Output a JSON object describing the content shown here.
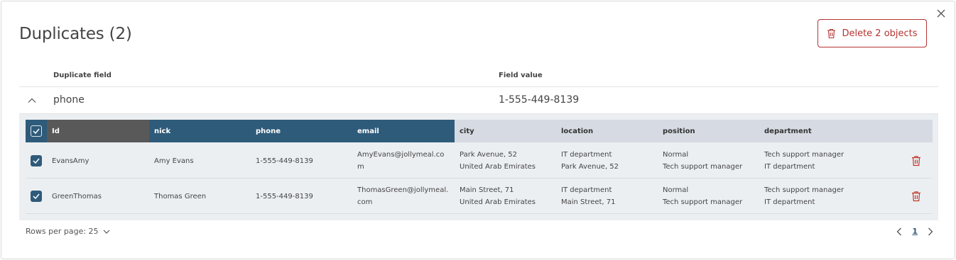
{
  "dialog": {
    "title": "Duplicates (2)",
    "delete_label": "Delete 2 objects"
  },
  "dup_header": {
    "field_label": "Duplicate field",
    "value_label": "Field value"
  },
  "dup_row": {
    "field": "phone",
    "value": "1-555-449-8139"
  },
  "grid": {
    "columns": [
      "Id",
      "nick",
      "phone",
      "email",
      "city",
      "location",
      "position",
      "department"
    ],
    "rows": [
      {
        "id": "EvansAmy",
        "nick": "Amy Evans",
        "phone": "1-555-449-8139",
        "email": [
          "AmyEvans@jollymeal.co",
          "m"
        ],
        "city": [
          "Park Avenue, 52",
          "United Arab Emirates"
        ],
        "location": [
          "IT department",
          "Park Avenue, 52"
        ],
        "position": [
          "Normal",
          "Tech support manager"
        ],
        "department": [
          "Tech support manager",
          "IT department"
        ]
      },
      {
        "id": "GreenThomas",
        "nick": "Thomas Green",
        "phone": "1-555-449-8139",
        "email": [
          "ThomasGreen@jollymeal.",
          "com"
        ],
        "city": [
          "Main Street, 71",
          "United Arab Emirates"
        ],
        "location": [
          "IT department",
          "Main Street, 71"
        ],
        "position": [
          "Normal",
          "Tech support manager"
        ],
        "department": [
          "Tech support manager",
          "IT department"
        ]
      }
    ]
  },
  "footer": {
    "rows_per_page": "Rows per page: 25",
    "page": "1"
  },
  "colors": {
    "accent": "#2f5b7a",
    "danger": "#b53232",
    "panel": "#eceff2",
    "header_gray": "#d6dbe3"
  }
}
